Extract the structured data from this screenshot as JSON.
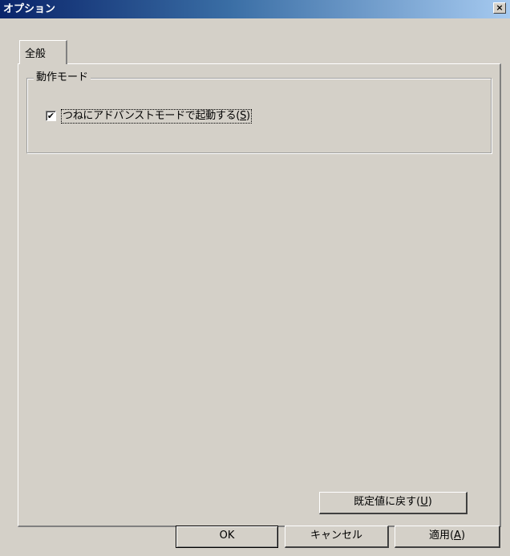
{
  "window": {
    "title": "オプション",
    "close_label": "×"
  },
  "tabs": [
    {
      "label": "全般",
      "selected": true
    }
  ],
  "general": {
    "group_title": "動作モード",
    "advanced_checkbox": {
      "label_text": "つねにアドバンストモードで起動する(",
      "accel": "S",
      "label_tail": ")",
      "checked": true,
      "check_glyph": "✔"
    },
    "restore_defaults": {
      "label_text": "既定値に戻す(",
      "accel": "U",
      "label_tail": ")"
    }
  },
  "footer": {
    "ok_label": "OK",
    "cancel_label": "キャンセル",
    "apply": {
      "label_text": "適用(",
      "accel": "A",
      "label_tail": ")"
    }
  }
}
